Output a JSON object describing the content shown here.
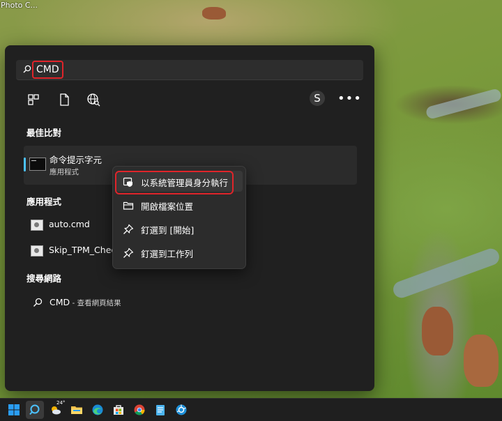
{
  "desktop": {
    "label": "Photo C..."
  },
  "search": {
    "query": "CMD"
  },
  "filters": [
    {
      "name": "apps-filter-icon"
    },
    {
      "name": "documents-filter-icon"
    },
    {
      "name": "web-filter-icon"
    }
  ],
  "account": {
    "initial": "S"
  },
  "more_label": "•••",
  "sections": {
    "best_match": "最佳比對",
    "apps": "應用程式",
    "web": "搜尋網路"
  },
  "best_match": {
    "name": "命令提示字元",
    "type": "應用程式"
  },
  "apps": [
    {
      "name": "auto.cmd"
    },
    {
      "name": "Skip_TPM_Chec"
    }
  ],
  "web_result": {
    "query": "CMD",
    "suffix": " - 查看網頁結果"
  },
  "context_menu": {
    "items": [
      {
        "label": "以系統管理員身分執行",
        "icon": "shield-icon"
      },
      {
        "label": "開啟檔案位置",
        "icon": "folder-icon"
      },
      {
        "label": "釘選到 [開始]",
        "icon": "pin-icon"
      },
      {
        "label": "釘選到工作列",
        "icon": "pin-icon"
      }
    ]
  },
  "taskbar": {
    "weather_temp": "24°",
    "apps": [
      "start-icon",
      "search-icon",
      "weather-icon",
      "file-explorer-icon",
      "edge-icon",
      "store-icon",
      "chrome-icon",
      "notepad-icon",
      "camera-app-icon"
    ]
  },
  "colors": {
    "accent": "#4cc2ff",
    "highlight_box": "#e0242a",
    "panel_bg": "#202020"
  }
}
